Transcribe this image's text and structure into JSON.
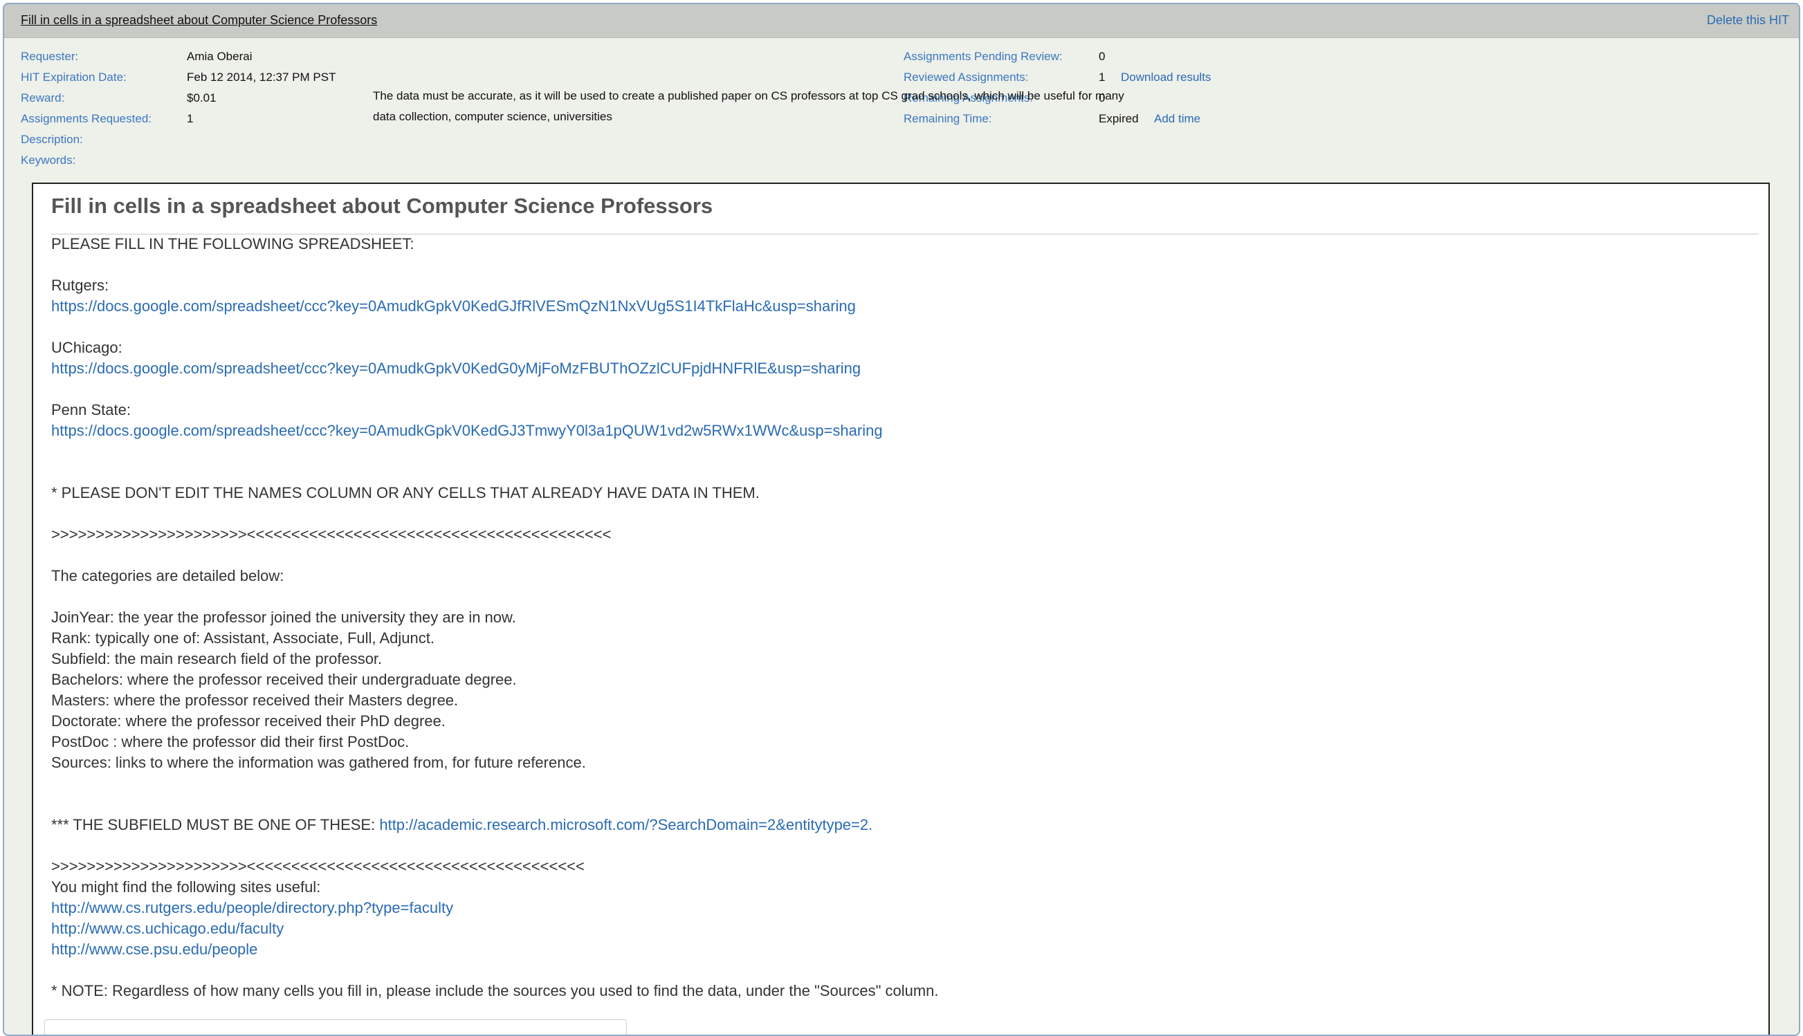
{
  "hit": {
    "title": "Fill in cells in a spreadsheet about Computer Science Professors",
    "delete_label": "Delete this HIT"
  },
  "meta_left": {
    "requester_label": "Requester:",
    "requester_value": "Amia Oberai",
    "expiration_label": "HIT Expiration Date:",
    "expiration_value": "Feb 12 2014, 12:37 PM PST",
    "reward_label": "Reward:",
    "reward_value": "$0.01",
    "requested_label": "Assignments Requested:",
    "requested_value": "1",
    "description_label": "Description:",
    "keywords_label": "Keywords:"
  },
  "meta_right": {
    "pending_label": "Assignments Pending Review:",
    "pending_value": "0",
    "reviewed_label": "Reviewed Assignments:",
    "reviewed_value": "1",
    "download_label": "Download results",
    "remaining_label": "Remaining Assignments:",
    "remaining_value": "0",
    "time_label": "Remaining Time:",
    "time_value": "Expired",
    "add_time_label": "Add time"
  },
  "description": {
    "line1": "The data must be accurate, as it will be used to create a published paper on CS professors at top CS grad schools, which will be useful for many",
    "line2": "data collection, computer science, universities"
  },
  "panel": {
    "heading": "Fill in cells in a spreadsheet about Computer Science Professors",
    "intro": " PLEASE FILL IN THE FOLLOWING SPREADSHEET:",
    "schools": [
      {
        "name": "Rutgers:",
        "url": "https://docs.google.com/spreadsheet/ccc?key=0AmudkGpkV0KedGJfRlVESmQzN1NxVUg5S1I4TkFlaHc&usp=sharing"
      },
      {
        "name": "UChicago:",
        "url": "https://docs.google.com/spreadsheet/ccc?key=0AmudkGpkV0KedG0yMjFoMzFBUThOZzlCUFpjdHNFRlE&usp=sharing"
      },
      {
        "name": "Penn State:",
        "url": "https://docs.google.com/spreadsheet/ccc?key=0AmudkGpkV0KedGJ3TmwyY0l3a1pQUW1vd2w5RWx1WWc&usp=sharing"
      }
    ],
    "warning": "* PLEASE DON'T EDIT THE NAMES COLUMN OR ANY CELLS THAT ALREADY HAVE DATA IN THEM.",
    "separator1": ">>>>>>>>>>>>>>>>>>>>>><<<<<<<<<<<<<<<<<<<<<<<<<<<<<<<<<<<<<<<<<",
    "categories_intro": "The categories are detailed below:",
    "categories": [
      "JoinYear: the year the professor joined the university they are in now.",
      "Rank: typically one of: Assistant, Associate, Full, Adjunct.",
      "Subfield: the main research field of the professor.",
      "Bachelors: where the professor received their undergraduate degree.",
      "Masters: where the professor received their Masters degree.",
      "Doctorate: where the professor received their PhD degree.",
      "PostDoc : where the professor did their first PostDoc.",
      "Sources: links to where the information was gathered from, for future reference."
    ],
    "subfield_prefix": "*** THE SUBFIELD MUST BE ONE OF THESE: ",
    "subfield_url": "http://academic.research.microsoft.com/?SearchDomain=2&entitytype=2.",
    "separator2": ">>>>>>>>>>>>>>>>>>>>>><<<<<<<<<<<<<<<<<<<<<<<<<<<<<<<<<<<<<<",
    "sites_intro": "You might find the following sites useful:",
    "sites": [
      "http://www.cs.rutgers.edu/people/directory.php?type=faculty",
      "http://www.cs.uchicago.edu/faculty",
      "http://www.cse.psu.edu/people"
    ],
    "note": "* NOTE: Regardless of how many cells you fill in, please include the sources you used to find the data, under the \"Sources\" column."
  }
}
